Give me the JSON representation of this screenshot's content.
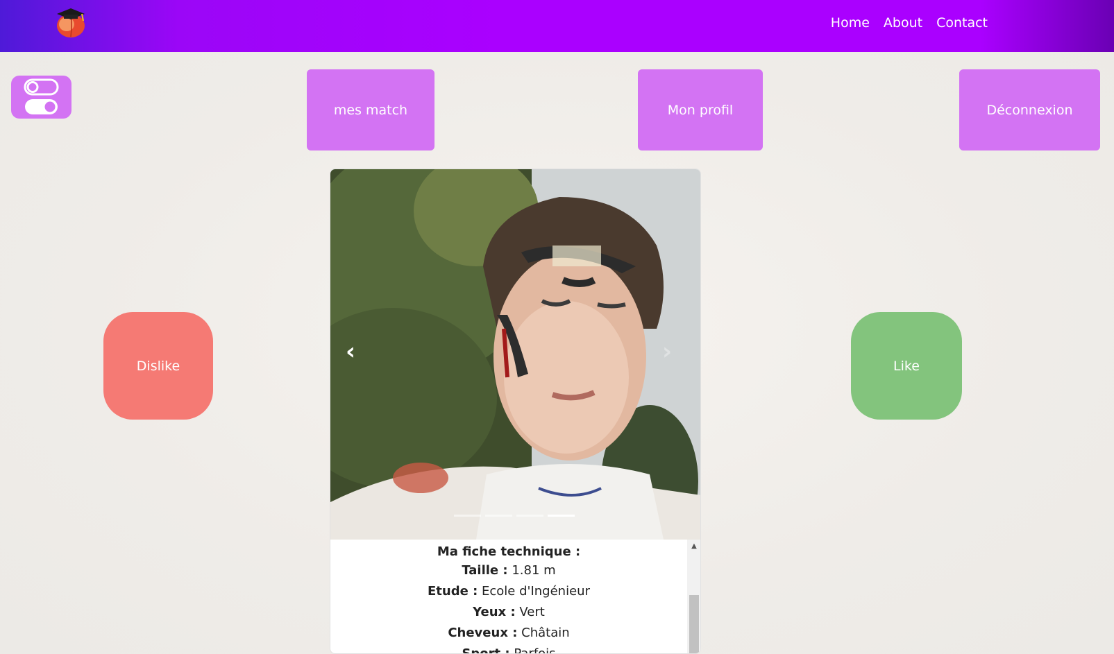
{
  "navbar": {
    "logo_icon": "peach-graduation-cap-icon",
    "links": [
      "Home",
      "About",
      "Contact"
    ]
  },
  "toolbar": {
    "toggle_icon": "toggle-switches-icon",
    "match_label": "mes match",
    "profile_label": "Mon profil",
    "logout_label": "Déconnexion"
  },
  "actions": {
    "dislike_label": "Dislike",
    "like_label": "Like"
  },
  "card": {
    "carousel": {
      "slide_count": 4,
      "active_index": 3,
      "prev_icon": "chevron-left-icon",
      "next_icon": "chevron-right-icon"
    },
    "info_title": "Ma fiche technique :",
    "fields": [
      {
        "label": "Taille :",
        "value": "1.81 m"
      },
      {
        "label": "Etude :",
        "value": "Ecole d'Ingénieur"
      },
      {
        "label": "Yeux :",
        "value": "Vert"
      },
      {
        "label": "Cheveux :",
        "value": "Châtain"
      },
      {
        "label": "Sport :",
        "value": "Parfois"
      }
    ]
  },
  "colors": {
    "button_purple": "#d373f3",
    "dislike_red": "#f57a74",
    "like_green": "#83c47d"
  }
}
